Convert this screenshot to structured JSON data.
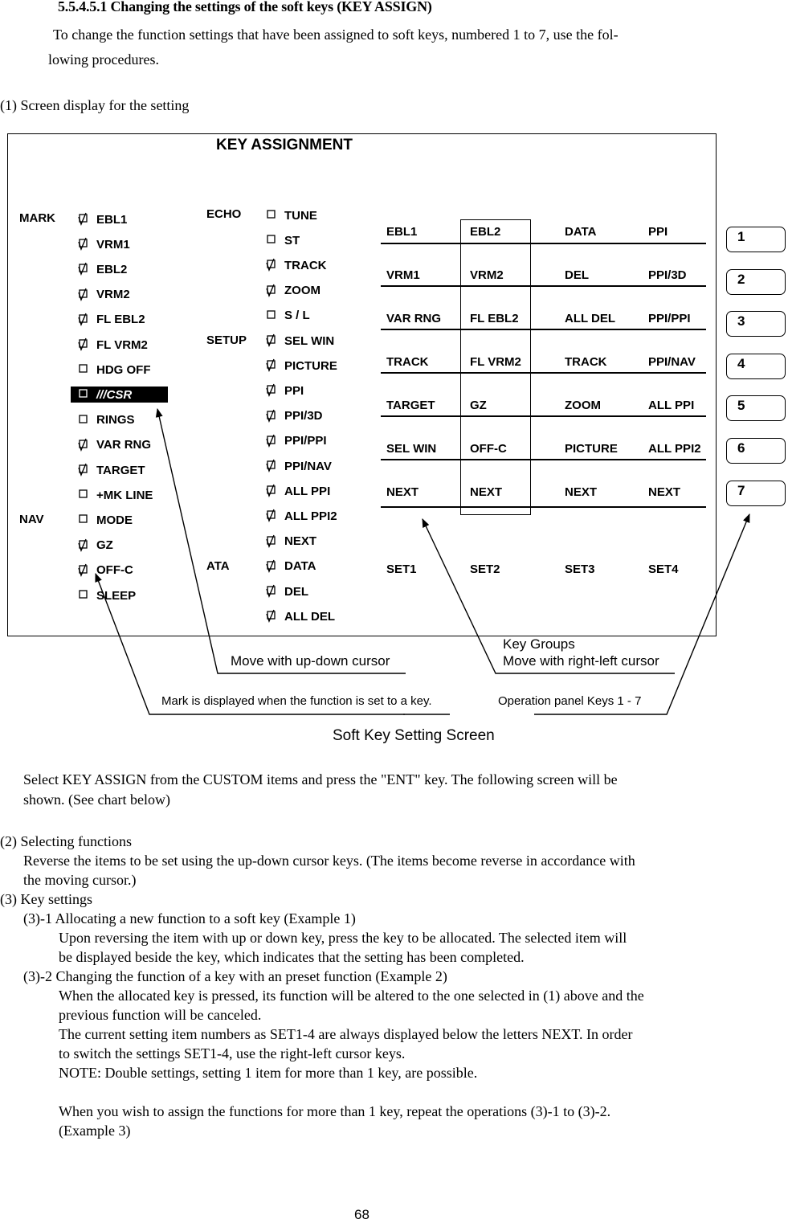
{
  "section": {
    "title": "5.5.4.5.1 Changing the settings of the soft keys (KEY ASSIGN)",
    "intro_line1": "To change the function settings that have been assigned to soft keys, numbered 1 to 7, use the fol-",
    "intro_line2": "lowing procedures.",
    "step1_heading": "(1)  Screen display for the setting"
  },
  "screen": {
    "title": "KEY ASSIGNMENT",
    "groups_left": [
      {
        "label": "MARK",
        "items": [
          {
            "label": "EBL1",
            "checked": true
          },
          {
            "label": "VRM1",
            "checked": true
          },
          {
            "label": "EBL2",
            "checked": true
          },
          {
            "label": "VRM2",
            "checked": true
          },
          {
            "label": "FL EBL2",
            "checked": true
          },
          {
            "label": "FL VRM2",
            "checked": true
          },
          {
            "label": "HDG OFF",
            "checked": false
          },
          {
            "label": "///CSR",
            "checked": false,
            "selected": true
          },
          {
            "label": "RINGS",
            "checked": false
          },
          {
            "label": "VAR RNG",
            "checked": true
          },
          {
            "label": "TARGET",
            "checked": true
          },
          {
            "label": "+MK LINE",
            "checked": false
          }
        ]
      },
      {
        "label": "NAV",
        "items": [
          {
            "label": "MODE",
            "checked": false
          },
          {
            "label": "GZ",
            "checked": true
          },
          {
            "label": "OFF-C",
            "checked": true
          },
          {
            "label": "SLEEP",
            "checked": false
          }
        ]
      }
    ],
    "groups_right": [
      {
        "label": "ECHO",
        "items": [
          {
            "label": "TUNE",
            "checked": false
          },
          {
            "label": "ST",
            "checked": false
          },
          {
            "label": "TRACK",
            "checked": true
          },
          {
            "label": "ZOOM",
            "checked": true
          },
          {
            "label": "S / L",
            "checked": false
          }
        ]
      },
      {
        "label": "SETUP",
        "items": [
          {
            "label": "SEL WIN",
            "checked": true
          },
          {
            "label": "PICTURE",
            "checked": true
          },
          {
            "label": "PPI",
            "checked": true
          },
          {
            "label": "PPI/3D",
            "checked": true
          },
          {
            "label": "PPI/PPI",
            "checked": true
          },
          {
            "label": "PPI/NAV",
            "checked": true
          },
          {
            "label": "ALL PPI",
            "checked": true
          },
          {
            "label": "ALL PPI2",
            "checked": true
          },
          {
            "label": "NEXT",
            "checked": true
          }
        ]
      },
      {
        "label": "ATA",
        "items": [
          {
            "label": "DATA",
            "checked": true
          },
          {
            "label": "DEL",
            "checked": true
          },
          {
            "label": "ALL DEL",
            "checked": true
          }
        ]
      }
    ],
    "key_sets": [
      {
        "name": "SET1",
        "keys": [
          "EBL1",
          "VRM1",
          "VAR RNG",
          "TRACK",
          "TARGET",
          "SEL WIN",
          "NEXT"
        ]
      },
      {
        "name": "SET2",
        "keys": [
          "EBL2",
          "VRM2",
          "FL EBL2",
          "FL VRM2",
          "GZ",
          "OFF-C",
          "NEXT"
        ],
        "highlighted": true
      },
      {
        "name": "SET3",
        "keys": [
          "DATA",
          "DEL",
          "ALL DEL",
          "TRACK",
          "ZOOM",
          "PICTURE",
          "NEXT"
        ]
      },
      {
        "name": "SET4",
        "keys": [
          "PPI",
          "PPI/3D",
          "PPI/PPI",
          "PPI/NAV",
          "ALL PPI",
          "ALL PPI2",
          "NEXT"
        ]
      }
    ],
    "soft_keys": [
      "1",
      "2",
      "3",
      "4",
      "5",
      "6",
      "7"
    ]
  },
  "annotations": {
    "up_down": "Move with up-down cursor",
    "key_groups_line1": "Key Groups",
    "key_groups_line2": "Move with right-left cursor",
    "mark_note": "Mark is displayed when the function is set to a key.",
    "panel_keys": "Operation panel Keys 1 - 7"
  },
  "figure_caption": "Soft Key Setting Screen",
  "body": {
    "select_line1": "Select KEY ASSIGN from the CUSTOM items and press the \"ENT\" key. The following screen will be",
    "select_line2": "shown. (See chart below)",
    "step2_heading": "(2)  Selecting functions",
    "step2_line1": "Reverse the items to be set using the up-down cursor keys.  (The items become reverse in accordance with",
    "step2_line2": "the moving cursor.)",
    "step3_heading": "(3)  Key settings",
    "step3_1_heading": "(3)-1  Allocating a new function to a soft key (Example 1)",
    "step3_1_line1": "Upon reversing the item with up or down key, press the key to be allocated.  The selected item will",
    "step3_1_line2": "be displayed beside the key, which indicates that the setting has been completed.",
    "step3_2_heading": "(3)-2  Changing the function of a key with an preset function (Example 2)",
    "step3_2_line1": "When the allocated key is pressed, its function will be altered to the one selected in (1) above and the",
    "step3_2_line2": "previous function will be canceled.",
    "step3_2_line3": "The current setting item numbers as SET1-4 are always displayed below the letters NEXT.  In order",
    "step3_2_line4": "to switch the settings SET1-4, use the right-left cursor keys.",
    "note": "NOTE: Double settings, setting 1 item for more than 1 key, are possible.",
    "repeat_line1": "When you wish to assign the functions for more than 1 key, repeat the operations (3)-1 to (3)-2.",
    "repeat_line2": "(Example 3)"
  },
  "page_number": "68"
}
